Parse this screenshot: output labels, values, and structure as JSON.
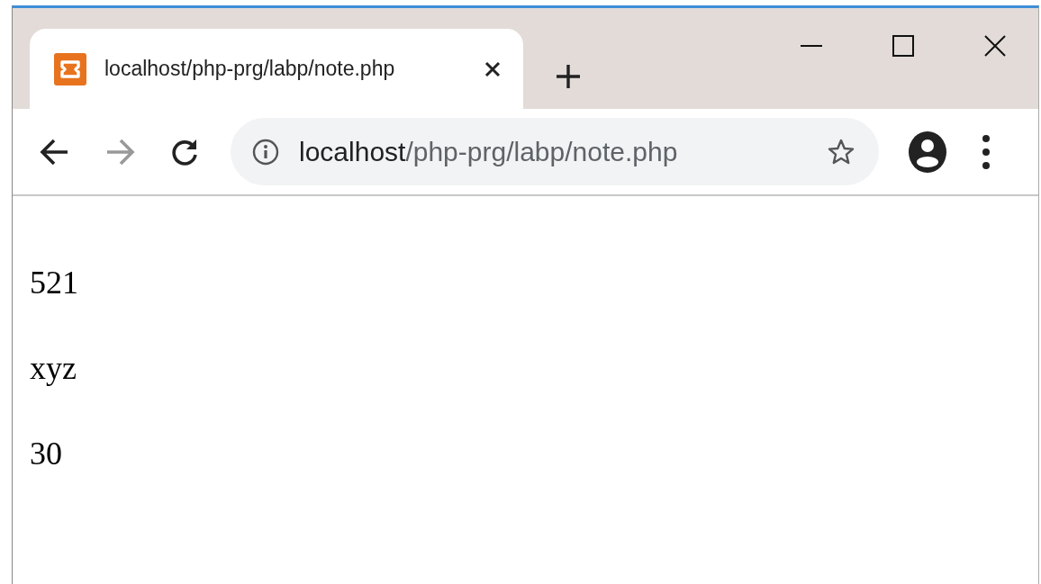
{
  "tabs": [
    {
      "title": "localhost/php-prg/labp/note.php",
      "selected": true
    }
  ],
  "address": {
    "host": "localhost",
    "path": "/php-prg/labp/note.php"
  },
  "content": [
    "521",
    "xyz",
    "30"
  ]
}
